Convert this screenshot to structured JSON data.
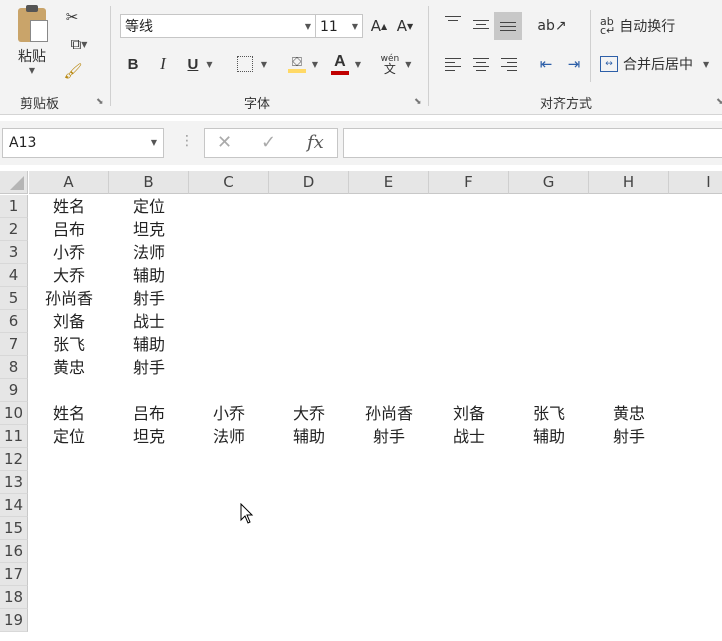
{
  "ribbon": {
    "clipboard": {
      "paste_label": "粘贴",
      "group_label": "剪贴板"
    },
    "font": {
      "font_name": "等线",
      "font_size": "11",
      "grow_label": "A",
      "shrink_label": "A",
      "bold_label": "B",
      "italic_label": "I",
      "underline_label": "U",
      "font_color_label": "A",
      "phonetic_label": "wén",
      "group_label": "字体",
      "fill_color": "#ffd966",
      "text_color": "#c00000"
    },
    "alignment": {
      "wrap_text_label": "自动换行",
      "merge_center_label": "合并后居中",
      "group_label": "对齐方式"
    }
  },
  "formula_bar": {
    "name_box": "A13",
    "cancel_icon": "✕",
    "enter_icon": "✓",
    "fx_label": "fx",
    "formula": ""
  },
  "columns": [
    "A",
    "B",
    "C",
    "D",
    "E",
    "F",
    "G",
    "H",
    "I"
  ],
  "rows": [
    "1",
    "2",
    "3",
    "4",
    "5",
    "6",
    "7",
    "8",
    "9",
    "10",
    "11",
    "12",
    "13",
    "14",
    "15",
    "16",
    "17",
    "18",
    "19"
  ],
  "cells": {
    "r1": [
      "姓名",
      "定位"
    ],
    "r2": [
      "吕布",
      "坦克"
    ],
    "r3": [
      "小乔",
      "法师"
    ],
    "r4": [
      "大乔",
      "辅助"
    ],
    "r5": [
      "孙尚香",
      "射手"
    ],
    "r6": [
      "刘备",
      "战士"
    ],
    "r7": [
      "张飞",
      "辅助"
    ],
    "r8": [
      "黄忠",
      "射手"
    ],
    "r10": [
      "姓名",
      "吕布",
      "小乔",
      "大乔",
      "孙尚香",
      "刘备",
      "张飞",
      "黄忠"
    ],
    "r11": [
      "定位",
      "坦克",
      "法师",
      "辅助",
      "射手",
      "战士",
      "辅助",
      "射手"
    ]
  }
}
